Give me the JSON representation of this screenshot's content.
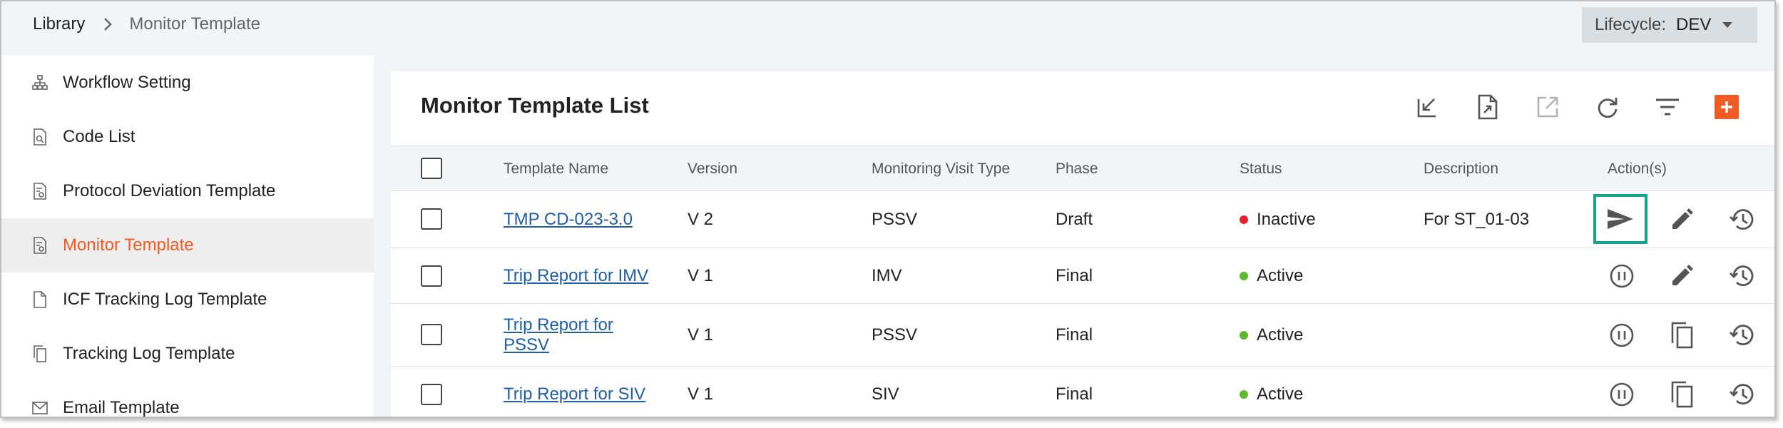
{
  "breadcrumb": {
    "root": "Library",
    "current": "Monitor Template"
  },
  "lifecycle": {
    "label": "Lifecycle:",
    "value": "DEV"
  },
  "sidebar": {
    "items": [
      {
        "label": "Workflow Setting",
        "icon": "hierarchy-icon"
      },
      {
        "label": "Code List",
        "icon": "document-search-icon"
      },
      {
        "label": "Protocol Deviation Template",
        "icon": "document-settings-icon"
      },
      {
        "label": "Monitor Template",
        "icon": "document-settings-icon",
        "active": true
      },
      {
        "label": "ICF Tracking Log Template",
        "icon": "file-icon"
      },
      {
        "label": "Tracking Log Template",
        "icon": "copy-icon"
      },
      {
        "label": "Email Template",
        "icon": "mail-icon"
      }
    ]
  },
  "main": {
    "title": "Monitor Template List",
    "toolbar": [
      "import-icon",
      "export-file-icon",
      "open-external-icon",
      "refresh-icon",
      "filter-icon",
      "add-icon"
    ],
    "columns": [
      "Template Name",
      "Version",
      "Monitoring Visit Type",
      "Phase",
      "Status",
      "Description",
      "Action(s)"
    ],
    "rows": [
      {
        "name": "TMP CD-023-3.0",
        "version": "V 2",
        "visit_type": "PSSV",
        "phase": "Draft",
        "status": "Inactive",
        "status_color": "#e8202a",
        "description": "For ST_01-03",
        "actions": [
          "send-icon",
          "edit-icon",
          "history-icon"
        ]
      },
      {
        "name": "Trip Report for IMV",
        "version": "V 1",
        "visit_type": "IMV",
        "phase": "Final",
        "status": "Active",
        "status_color": "#5cb82e",
        "description": "",
        "actions": [
          "pause-icon",
          "edit-icon",
          "history-icon"
        ]
      },
      {
        "name": "Trip Report for PSSV",
        "version": "V 1",
        "visit_type": "PSSV",
        "phase": "Final",
        "status": "Active",
        "status_color": "#5cb82e",
        "description": "",
        "actions": [
          "pause-icon",
          "copy-icon",
          "history-icon"
        ]
      },
      {
        "name": "Trip Report for SIV",
        "version": "V 1",
        "visit_type": "SIV",
        "phase": "Final",
        "status": "Active",
        "status_color": "#5cb82e",
        "description": "",
        "actions": [
          "pause-icon",
          "copy-icon",
          "history-icon"
        ]
      }
    ]
  },
  "colors": {
    "accent": "#f15a22",
    "link": "#1f5fa8",
    "highlight": "#17a589",
    "active": "#5cb82e",
    "inactive": "#e8202a"
  }
}
